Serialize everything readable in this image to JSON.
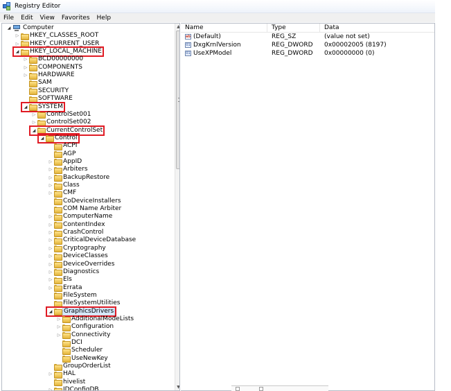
{
  "window": {
    "title": "Registry Editor"
  },
  "menu": [
    "File",
    "Edit",
    "View",
    "Favorites",
    "Help"
  ],
  "tree": [
    "Computer",
    "HKEY_CLASSES_ROOT",
    "HKEY_CURRENT_USER",
    "HKEY_LOCAL_MACHINE",
    "BCD00000000",
    "COMPONENTS",
    "HARDWARE",
    "SAM",
    "SECURITY",
    "SOFTWARE",
    "SYSTEM",
    "ControlSet001",
    "ControlSet002",
    "CurrentControlSet",
    "Control",
    "ACPI",
    "AGP",
    "AppID",
    "Arbiters",
    "BackupRestore",
    "Class",
    "CMF",
    "CoDeviceInstallers",
    "COM Name Arbiter",
    "ComputerName",
    "ContentIndex",
    "CrashControl",
    "CriticalDeviceDatabase",
    "Cryptography",
    "DeviceClasses",
    "DeviceOverrides",
    "Diagnostics",
    "Els",
    "Errata",
    "FileSystem",
    "FileSystemUtilities",
    "GraphicsDrivers",
    "AdditionalModeLists",
    "Configuration",
    "Connectivity",
    "DCI",
    "Scheduler",
    "UseNewKey",
    "GroupOrderList",
    "HAL",
    "hivelist",
    "IDConfigDB"
  ],
  "list": {
    "columns": [
      "Name",
      "Type",
      "Data"
    ],
    "rows": [
      {
        "name": "(Default)",
        "type": "REG_SZ",
        "data": "(value not set)",
        "icon": "string-value-icon"
      },
      {
        "name": "DxgKrnlVersion",
        "type": "REG_DWORD",
        "data": "0x00002005 (8197)",
        "icon": "binary-value-icon"
      },
      {
        "name": "UseXPModel",
        "type": "REG_DWORD",
        "data": "0x00000000 (0)",
        "icon": "binary-value-icon"
      }
    ]
  },
  "colors": {
    "highlight": "#e01b24",
    "folder": "#f5c542"
  }
}
